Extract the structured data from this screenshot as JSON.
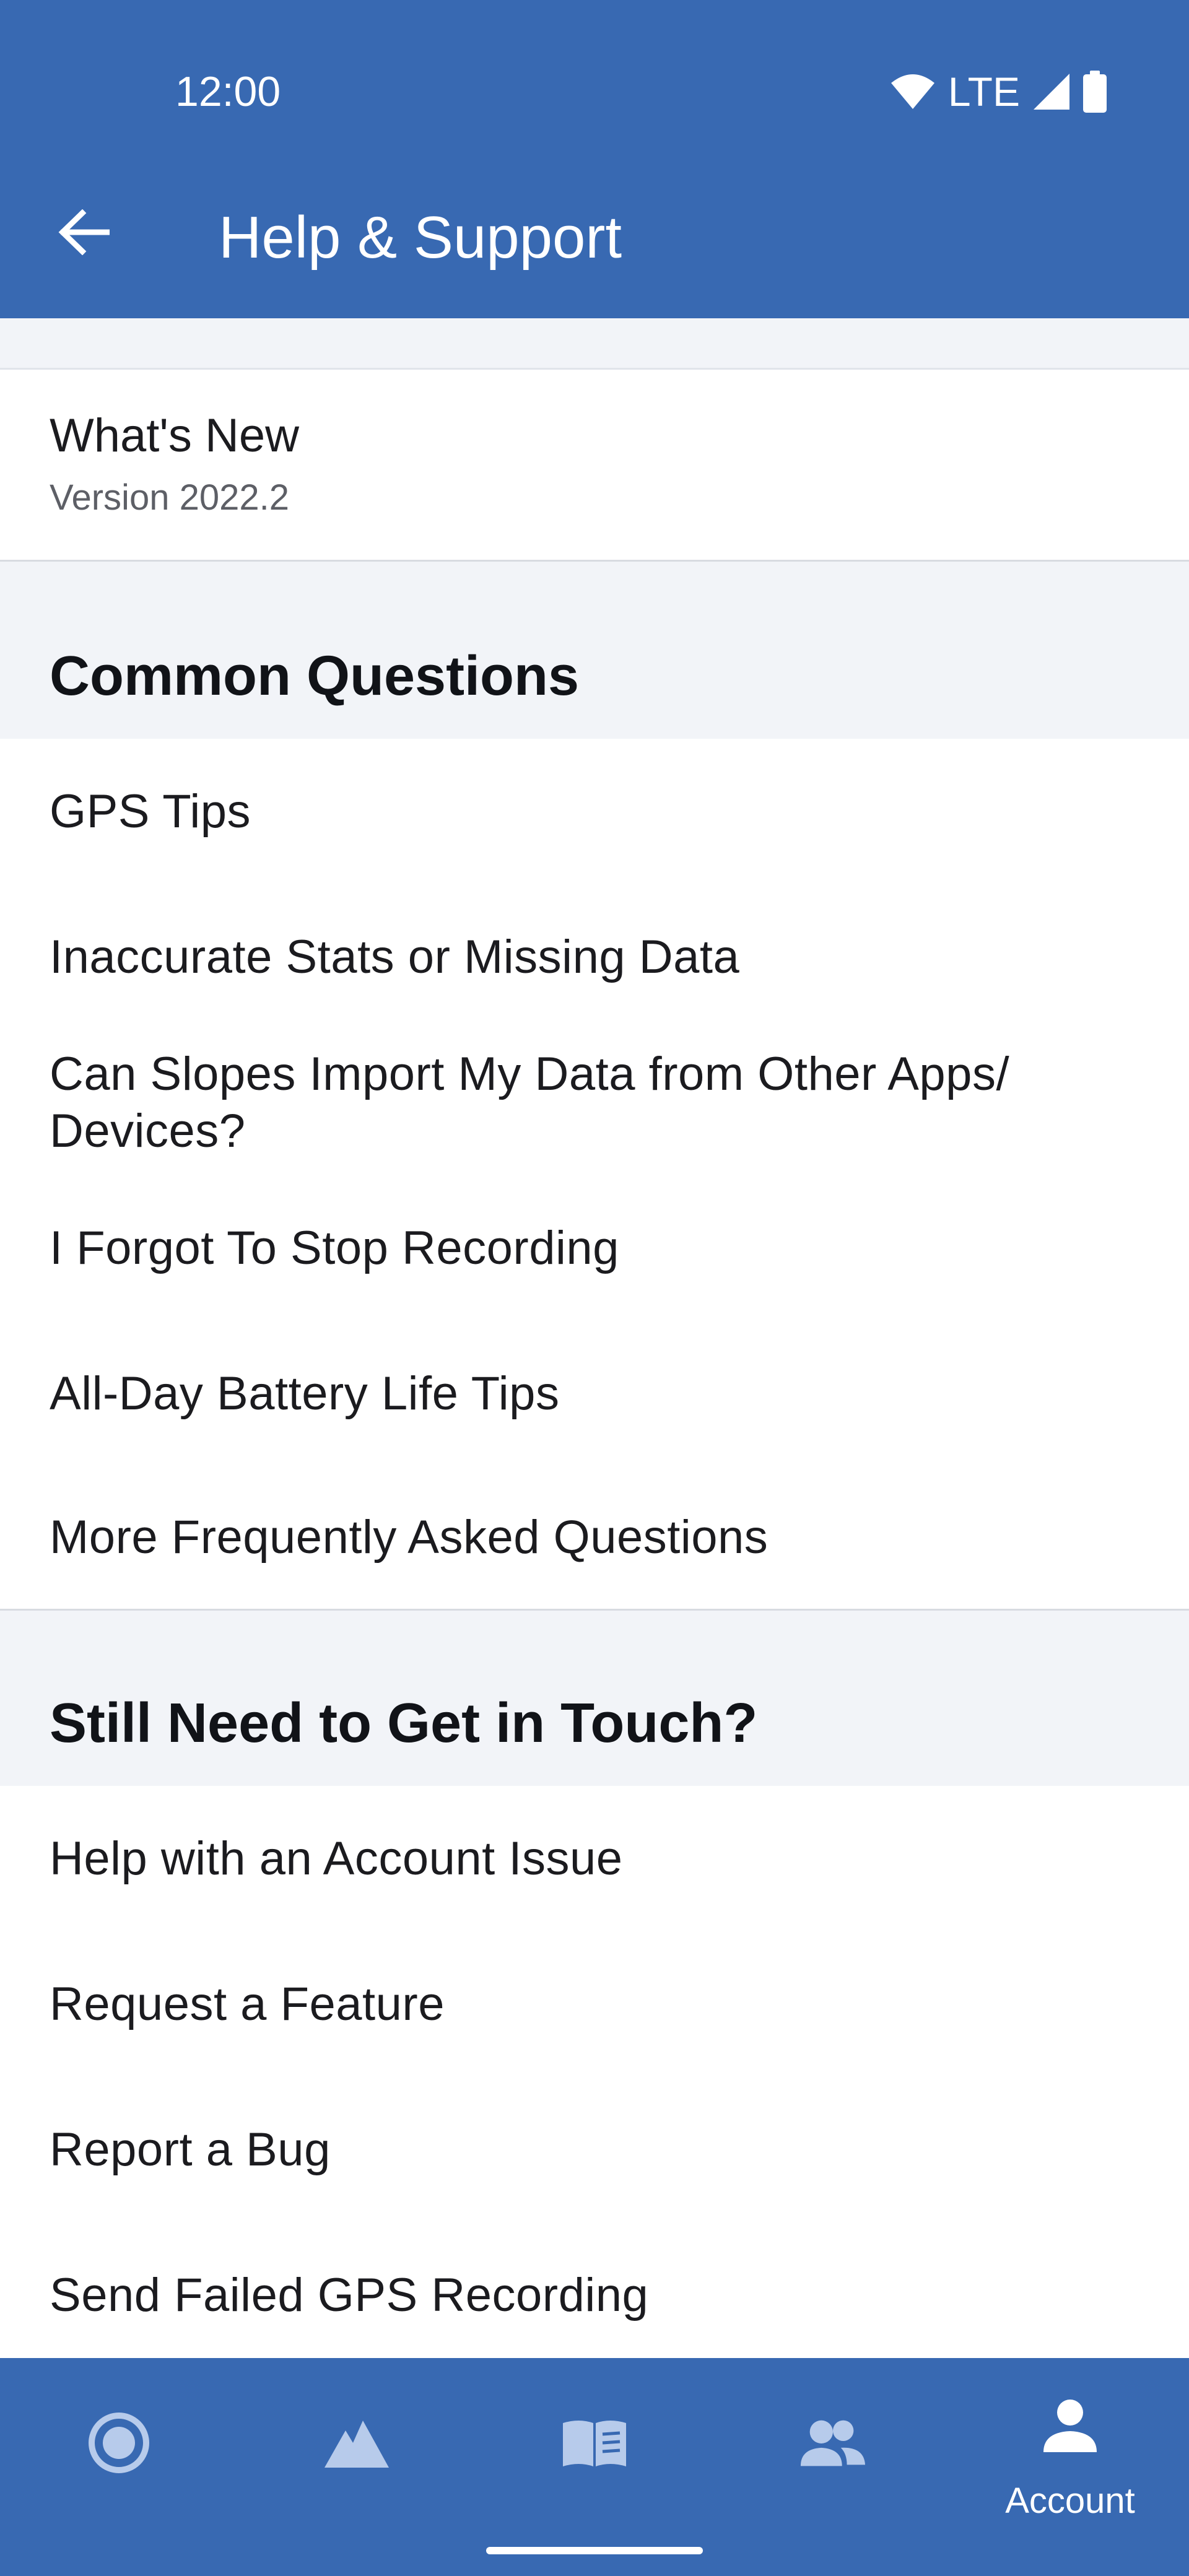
{
  "status_bar": {
    "time": "12:00",
    "network": "LTE",
    "icons": [
      "wifi-icon",
      "cell-signal-icon",
      "battery-icon"
    ]
  },
  "header": {
    "title": "Help & Support",
    "back_icon": "arrow-back-icon"
  },
  "whats_new": {
    "title": "What's New",
    "version": "Version 2022.2"
  },
  "common_questions": {
    "heading": "Common Questions",
    "items": [
      "GPS Tips",
      "Inaccurate Stats or Missing Data",
      "Can Slopes Import My Data from Other Apps/ Devices?",
      "I Forgot To Stop Recording",
      "All-Day Battery Life Tips",
      "More Frequently Asked Questions"
    ]
  },
  "get_in_touch": {
    "heading": "Still Need to Get in Touch?",
    "items": [
      "Help with an Account Issue",
      "Request a Feature",
      "Report a Bug",
      "Send Failed GPS Recording"
    ]
  },
  "bottom_nav": {
    "items": [
      {
        "icon": "record-icon",
        "label": ""
      },
      {
        "icon": "mountain-icon",
        "label": ""
      },
      {
        "icon": "logbook-icon",
        "label": ""
      },
      {
        "icon": "friends-icon",
        "label": ""
      },
      {
        "icon": "account-icon",
        "label": "Account"
      }
    ],
    "active_index": 4
  },
  "colors": {
    "primary": "#3869b2",
    "section_background": "#f2f4f8",
    "inactive_nav_icon": "#b7cbeb",
    "text": "#1b1b1f",
    "secondary_text": "#5d5f66"
  }
}
